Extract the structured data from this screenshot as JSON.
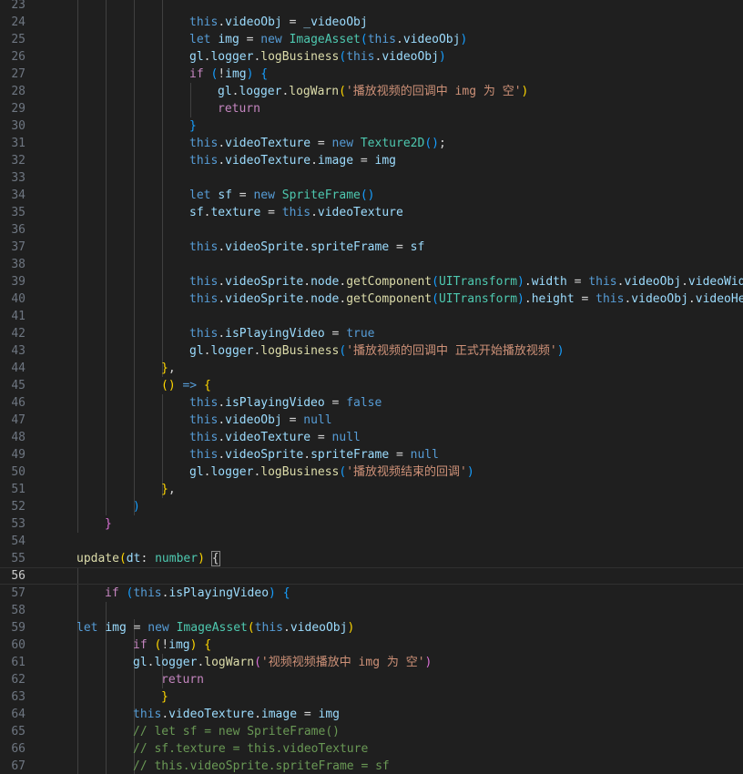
{
  "editor": {
    "colors": {
      "background": "#1f1f1f",
      "keyword": "#569cd6",
      "control": "#c586c0",
      "variable": "#9cdcfe",
      "function": "#dcdcaa",
      "class": "#4ec9b0",
      "string": "#ce9178",
      "comment": "#6a9955",
      "bracket_gold": "#ffd700",
      "bracket_orchid": "#da70d6",
      "bracket_blue": "#179fff"
    },
    "lines": [
      {
        "n": "23",
        "tokens": []
      },
      {
        "n": "24",
        "tokens": [
          [
            "k",
            "this"
          ],
          [
            "p",
            "."
          ],
          [
            "v",
            "videoObj"
          ],
          [
            "p",
            " = "
          ],
          [
            "v",
            "_videoObj"
          ]
        ]
      },
      {
        "n": "25",
        "tokens": [
          [
            "k",
            "let"
          ],
          [
            "p",
            " "
          ],
          [
            "v",
            "img"
          ],
          [
            "p",
            " = "
          ],
          [
            "k",
            "new"
          ],
          [
            "p",
            " "
          ],
          [
            "c",
            "ImageAsset"
          ],
          [
            "b3",
            "("
          ],
          [
            "k",
            "this"
          ],
          [
            "p",
            "."
          ],
          [
            "v",
            "videoObj"
          ],
          [
            "b3",
            ")"
          ]
        ]
      },
      {
        "n": "26",
        "tokens": [
          [
            "v",
            "gl"
          ],
          [
            "p",
            "."
          ],
          [
            "v",
            "logger"
          ],
          [
            "p",
            "."
          ],
          [
            "f",
            "logBusiness"
          ],
          [
            "b3",
            "("
          ],
          [
            "k",
            "this"
          ],
          [
            "p",
            "."
          ],
          [
            "v",
            "videoObj"
          ],
          [
            "b3",
            ")"
          ]
        ]
      },
      {
        "n": "27",
        "tokens": [
          [
            "x",
            "if"
          ],
          [
            "p",
            " "
          ],
          [
            "b3",
            "("
          ],
          [
            "p",
            "!"
          ],
          [
            "v",
            "img"
          ],
          [
            "b3",
            ")"
          ],
          [
            "p",
            " "
          ],
          [
            "b3",
            "{"
          ]
        ]
      },
      {
        "n": "28",
        "tokens": [
          [
            "v",
            "gl"
          ],
          [
            "p",
            "."
          ],
          [
            "v",
            "logger"
          ],
          [
            "p",
            "."
          ],
          [
            "f",
            "logWarn"
          ],
          [
            "b1",
            "("
          ],
          [
            "s",
            "'播放视频的回调中 img 为 空'"
          ],
          [
            "b1",
            ")"
          ]
        ]
      },
      {
        "n": "29",
        "tokens": [
          [
            "x",
            "return"
          ]
        ]
      },
      {
        "n": "30",
        "tokens": [
          [
            "b3",
            "}"
          ]
        ]
      },
      {
        "n": "31",
        "tokens": [
          [
            "k",
            "this"
          ],
          [
            "p",
            "."
          ],
          [
            "v",
            "videoTexture"
          ],
          [
            "p",
            " = "
          ],
          [
            "k",
            "new"
          ],
          [
            "p",
            " "
          ],
          [
            "c",
            "Texture2D"
          ],
          [
            "b3",
            "()"
          ],
          [
            "p",
            ";"
          ]
        ]
      },
      {
        "n": "32",
        "tokens": [
          [
            "k",
            "this"
          ],
          [
            "p",
            "."
          ],
          [
            "v",
            "videoTexture"
          ],
          [
            "p",
            "."
          ],
          [
            "v",
            "image"
          ],
          [
            "p",
            " = "
          ],
          [
            "v",
            "img"
          ]
        ]
      },
      {
        "n": "33",
        "tokens": []
      },
      {
        "n": "34",
        "tokens": [
          [
            "k",
            "let"
          ],
          [
            "p",
            " "
          ],
          [
            "v",
            "sf"
          ],
          [
            "p",
            " = "
          ],
          [
            "k",
            "new"
          ],
          [
            "p",
            " "
          ],
          [
            "c",
            "SpriteFrame"
          ],
          [
            "b3",
            "()"
          ]
        ]
      },
      {
        "n": "35",
        "tokens": [
          [
            "v",
            "sf"
          ],
          [
            "p",
            "."
          ],
          [
            "v",
            "texture"
          ],
          [
            "p",
            " = "
          ],
          [
            "k",
            "this"
          ],
          [
            "p",
            "."
          ],
          [
            "v",
            "videoTexture"
          ]
        ]
      },
      {
        "n": "36",
        "tokens": []
      },
      {
        "n": "37",
        "tokens": [
          [
            "k",
            "this"
          ],
          [
            "p",
            "."
          ],
          [
            "v",
            "videoSprite"
          ],
          [
            "p",
            "."
          ],
          [
            "v",
            "spriteFrame"
          ],
          [
            "p",
            " = "
          ],
          [
            "v",
            "sf"
          ]
        ]
      },
      {
        "n": "38",
        "tokens": []
      },
      {
        "n": "39",
        "tokens": [
          [
            "k",
            "this"
          ],
          [
            "p",
            "."
          ],
          [
            "v",
            "videoSprite"
          ],
          [
            "p",
            "."
          ],
          [
            "v",
            "node"
          ],
          [
            "p",
            "."
          ],
          [
            "f",
            "getComponent"
          ],
          [
            "b3",
            "("
          ],
          [
            "c",
            "UITransform"
          ],
          [
            "b3",
            ")"
          ],
          [
            "p",
            "."
          ],
          [
            "v",
            "width"
          ],
          [
            "p",
            " = "
          ],
          [
            "k",
            "this"
          ],
          [
            "p",
            "."
          ],
          [
            "v",
            "videoObj"
          ],
          [
            "p",
            "."
          ],
          [
            "v",
            "videoWidth"
          ]
        ]
      },
      {
        "n": "40",
        "tokens": [
          [
            "k",
            "this"
          ],
          [
            "p",
            "."
          ],
          [
            "v",
            "videoSprite"
          ],
          [
            "p",
            "."
          ],
          [
            "v",
            "node"
          ],
          [
            "p",
            "."
          ],
          [
            "f",
            "getComponent"
          ],
          [
            "b3",
            "("
          ],
          [
            "c",
            "UITransform"
          ],
          [
            "b3",
            ")"
          ],
          [
            "p",
            "."
          ],
          [
            "v",
            "height"
          ],
          [
            "p",
            " = "
          ],
          [
            "k",
            "this"
          ],
          [
            "p",
            "."
          ],
          [
            "v",
            "videoObj"
          ],
          [
            "p",
            "."
          ],
          [
            "v",
            "videoHeight"
          ]
        ]
      },
      {
        "n": "41",
        "tokens": []
      },
      {
        "n": "42",
        "tokens": [
          [
            "k",
            "this"
          ],
          [
            "p",
            "."
          ],
          [
            "v",
            "isPlayingVideo"
          ],
          [
            "p",
            " = "
          ],
          [
            "k",
            "true"
          ]
        ]
      },
      {
        "n": "43",
        "tokens": [
          [
            "v",
            "gl"
          ],
          [
            "p",
            "."
          ],
          [
            "v",
            "logger"
          ],
          [
            "p",
            "."
          ],
          [
            "f",
            "logBusiness"
          ],
          [
            "b3",
            "("
          ],
          [
            "s",
            "'播放视频的回调中 正式开始播放视频'"
          ],
          [
            "b3",
            ")"
          ]
        ]
      },
      {
        "n": "44",
        "tokens": [
          [
            "b1",
            "}"
          ],
          [
            "p",
            ","
          ]
        ]
      },
      {
        "n": "45",
        "tokens": [
          [
            "b1",
            "()"
          ],
          [
            "p",
            " "
          ],
          [
            "k",
            "=>"
          ],
          [
            "p",
            " "
          ],
          [
            "b1",
            "{"
          ]
        ]
      },
      {
        "n": "46",
        "tokens": [
          [
            "k",
            "this"
          ],
          [
            "p",
            "."
          ],
          [
            "v",
            "isPlayingVideo"
          ],
          [
            "p",
            " = "
          ],
          [
            "k",
            "false"
          ]
        ]
      },
      {
        "n": "47",
        "tokens": [
          [
            "k",
            "this"
          ],
          [
            "p",
            "."
          ],
          [
            "v",
            "videoObj"
          ],
          [
            "p",
            " = "
          ],
          [
            "k",
            "null"
          ]
        ]
      },
      {
        "n": "48",
        "tokens": [
          [
            "k",
            "this"
          ],
          [
            "p",
            "."
          ],
          [
            "v",
            "videoTexture"
          ],
          [
            "p",
            " = "
          ],
          [
            "k",
            "null"
          ]
        ]
      },
      {
        "n": "49",
        "tokens": [
          [
            "k",
            "this"
          ],
          [
            "p",
            "."
          ],
          [
            "v",
            "videoSprite"
          ],
          [
            "p",
            "."
          ],
          [
            "v",
            "spriteFrame"
          ],
          [
            "p",
            " = "
          ],
          [
            "k",
            "null"
          ]
        ]
      },
      {
        "n": "50",
        "tokens": [
          [
            "v",
            "gl"
          ],
          [
            "p",
            "."
          ],
          [
            "v",
            "logger"
          ],
          [
            "p",
            "."
          ],
          [
            "f",
            "logBusiness"
          ],
          [
            "b3",
            "("
          ],
          [
            "s",
            "'播放视频结束的回调'"
          ],
          [
            "b3",
            ")"
          ]
        ]
      },
      {
        "n": "51",
        "tokens": [
          [
            "b1",
            "}"
          ],
          [
            "p",
            ","
          ]
        ]
      },
      {
        "n": "52",
        "tokens": [
          [
            "b3",
            ")"
          ]
        ]
      },
      {
        "n": "53",
        "tokens": [
          [
            "b2",
            "}"
          ]
        ]
      },
      {
        "n": "54",
        "tokens": []
      },
      {
        "n": "55",
        "tokens": [
          [
            "f",
            "update"
          ],
          [
            "b1",
            "("
          ],
          [
            "v",
            "dt"
          ],
          [
            "p",
            ": "
          ],
          [
            "c",
            "number"
          ],
          [
            "b1",
            ")"
          ],
          [
            "p",
            " "
          ],
          [
            "bx",
            "{"
          ]
        ]
      },
      {
        "n": "56",
        "tokens": []
      },
      {
        "n": "57",
        "tokens": [
          [
            "x",
            "if"
          ],
          [
            "p",
            " "
          ],
          [
            "b3",
            "("
          ],
          [
            "k",
            "this"
          ],
          [
            "p",
            "."
          ],
          [
            "v",
            "isPlayingVideo"
          ],
          [
            "b3",
            ")"
          ],
          [
            "p",
            " "
          ],
          [
            "b3",
            "{"
          ]
        ]
      },
      {
        "n": "58",
        "tokens": []
      },
      {
        "n": "59",
        "tokens": [
          [
            "k",
            "let"
          ],
          [
            "p",
            " "
          ],
          [
            "v",
            "img"
          ],
          [
            "p",
            " = "
          ],
          [
            "k",
            "new"
          ],
          [
            "p",
            " "
          ],
          [
            "c",
            "ImageAsset"
          ],
          [
            "b1",
            "("
          ],
          [
            "k",
            "this"
          ],
          [
            "p",
            "."
          ],
          [
            "v",
            "videoObj"
          ],
          [
            "b1",
            ")"
          ]
        ]
      },
      {
        "n": "60",
        "tokens": [
          [
            "x",
            "if"
          ],
          [
            "p",
            " "
          ],
          [
            "b1",
            "("
          ],
          [
            "p",
            "!"
          ],
          [
            "v",
            "img"
          ],
          [
            "b1",
            ")"
          ],
          [
            "p",
            " "
          ],
          [
            "b1",
            "{"
          ]
        ]
      },
      {
        "n": "61",
        "tokens": [
          [
            "v",
            "gl"
          ],
          [
            "p",
            "."
          ],
          [
            "v",
            "logger"
          ],
          [
            "p",
            "."
          ],
          [
            "f",
            "logWarn"
          ],
          [
            "b2",
            "("
          ],
          [
            "s",
            "'视频视频播放中 img 为 空'"
          ],
          [
            "b2",
            ")"
          ]
        ]
      },
      {
        "n": "62",
        "tokens": [
          [
            "x",
            "return"
          ]
        ]
      },
      {
        "n": "63",
        "tokens": [
          [
            "b1",
            "}"
          ]
        ]
      },
      {
        "n": "64",
        "tokens": [
          [
            "k",
            "this"
          ],
          [
            "p",
            "."
          ],
          [
            "v",
            "videoTexture"
          ],
          [
            "p",
            "."
          ],
          [
            "v",
            "image"
          ],
          [
            "p",
            " = "
          ],
          [
            "v",
            "img"
          ]
        ]
      },
      {
        "n": "65",
        "tokens": [
          [
            "m",
            "// let sf = new SpriteFrame()"
          ]
        ]
      },
      {
        "n": "66",
        "tokens": [
          [
            "m",
            "// sf.texture = this.videoTexture"
          ]
        ]
      },
      {
        "n": "67",
        "tokens": [
          [
            "m",
            "// this.videoSprite.spriteFrame = sf"
          ]
        ]
      }
    ]
  }
}
